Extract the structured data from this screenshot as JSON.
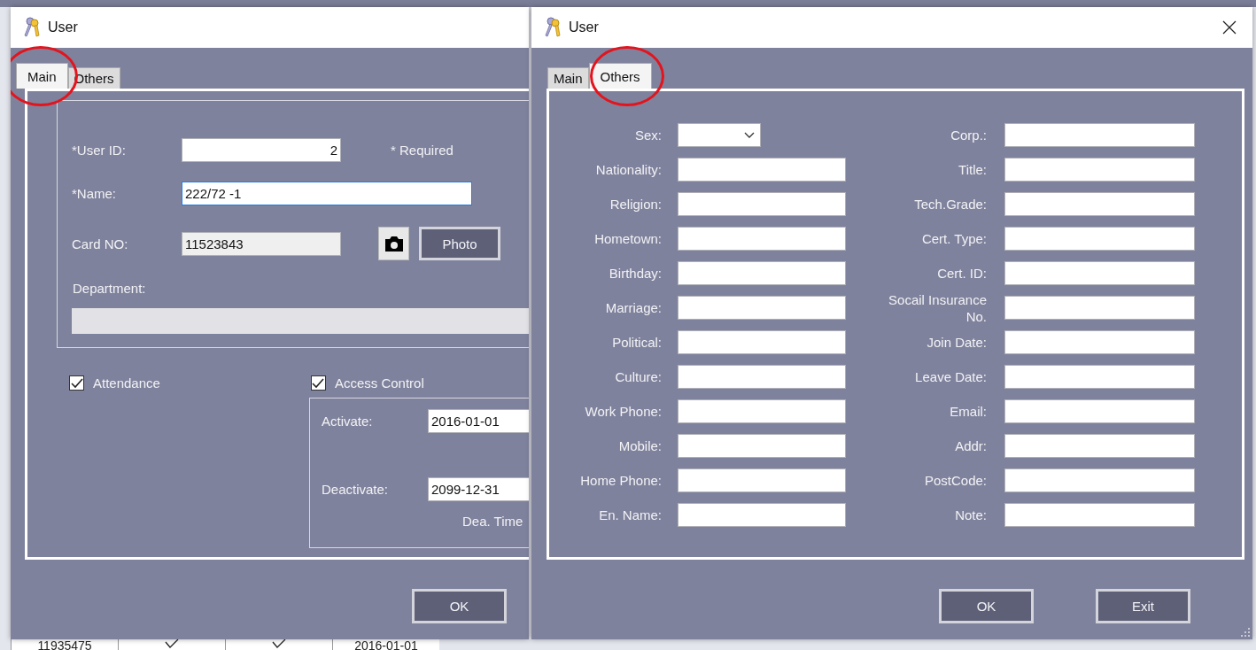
{
  "background_table": {
    "cells": [
      {
        "kind": "text",
        "text": "11935475"
      },
      {
        "kind": "check",
        "checked": true
      },
      {
        "kind": "check",
        "checked": true
      },
      {
        "kind": "text",
        "text": "2016-01-01"
      }
    ]
  },
  "dialogs": [
    {
      "kind": "main",
      "title": "User",
      "close_button": false,
      "resize_grip": false,
      "tabs": [
        {
          "label": "Main",
          "selected": true,
          "highlighted": true
        },
        {
          "label": "Others",
          "selected": false,
          "highlighted": false
        }
      ],
      "main": {
        "user_id": {
          "label": "*User ID:",
          "value": "2",
          "disabled": false
        },
        "required_note": "* Required",
        "name": {
          "label": "*Name:",
          "value": "222/72 -1",
          "disabled": false,
          "focused": true
        },
        "card_no": {
          "label": "Card NO:",
          "value": "11523843",
          "disabled": true
        },
        "photo_button": "Photo",
        "department": {
          "label": "Department:",
          "disabled": true
        },
        "checkboxes": [
          {
            "label": "Attendance",
            "checked": true
          },
          {
            "label": "Access Control",
            "checked": true
          }
        ],
        "activate": {
          "label": "Activate:",
          "value": "2016-01-01"
        },
        "deactivate": {
          "label": "Deactivate:",
          "value": "2099-12-31"
        },
        "dea_time": "Dea. Time"
      },
      "buttons": [
        "OK"
      ]
    },
    {
      "kind": "others",
      "title": "User",
      "close_button": true,
      "resize_grip": true,
      "tabs": [
        {
          "label": "Main",
          "selected": false,
          "highlighted": false
        },
        {
          "label": "Others",
          "selected": true,
          "highlighted": true
        }
      ],
      "left_fields": [
        {
          "label": "Sex:",
          "kind": "dropdown"
        },
        {
          "label": "Nationality:",
          "kind": "text"
        },
        {
          "label": "Religion:",
          "kind": "text"
        },
        {
          "label": "Hometown:",
          "kind": "text"
        },
        {
          "label": "Birthday:",
          "kind": "text"
        },
        {
          "label": "Marriage:",
          "kind": "text"
        },
        {
          "label": "Political:",
          "kind": "text"
        },
        {
          "label": "Culture:",
          "kind": "text"
        },
        {
          "label": "Work Phone:",
          "kind": "text"
        },
        {
          "label": "Mobile:",
          "kind": "text"
        },
        {
          "label": "Home Phone:",
          "kind": "text"
        },
        {
          "label": "En. Name:",
          "kind": "text"
        }
      ],
      "right_fields": [
        {
          "label": "Corp.:",
          "kind": "text"
        },
        {
          "label": "Title:",
          "kind": "text"
        },
        {
          "label": "Tech.Grade:",
          "kind": "text"
        },
        {
          "label": "Cert. Type:",
          "kind": "text"
        },
        {
          "label": "Cert. ID:",
          "kind": "text"
        },
        {
          "label": "Socail Insurance No.",
          "kind": "text"
        },
        {
          "label": "Join Date:",
          "kind": "text"
        },
        {
          "label": "Leave Date:",
          "kind": "text"
        },
        {
          "label": "Email:",
          "kind": "text"
        },
        {
          "label": "Addr:",
          "kind": "text"
        },
        {
          "label": "PostCode:",
          "kind": "text"
        },
        {
          "label": "Note:",
          "kind": "text"
        }
      ],
      "buttons": [
        "OK",
        "Exit"
      ]
    }
  ]
}
